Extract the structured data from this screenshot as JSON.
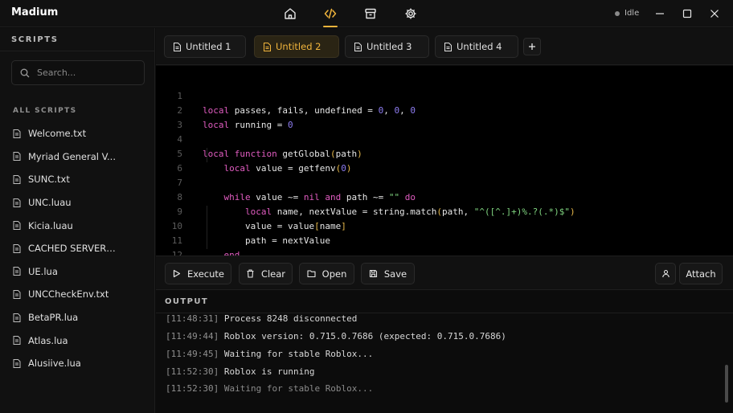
{
  "app": {
    "title": "Madium"
  },
  "nav": [
    {
      "name": "home-icon"
    },
    {
      "name": "code-icon",
      "active": true
    },
    {
      "name": "archive-icon"
    },
    {
      "name": "gear-icon"
    }
  ],
  "status": {
    "label": "Idle"
  },
  "sidebar": {
    "title": "SCRIPTS",
    "search_placeholder": "Search...",
    "section_label": "ALL SCRIPTS",
    "items": [
      {
        "label": "Welcome.txt"
      },
      {
        "label": "Myriad General V..."
      },
      {
        "label": "SUNC.txt"
      },
      {
        "label": "UNC.luau"
      },
      {
        "label": "Kicia.luau"
      },
      {
        "label": "CACHED SERVERH..."
      },
      {
        "label": "UE.lua"
      },
      {
        "label": "UNCCheckEnv.txt"
      },
      {
        "label": "BetaPR.lua"
      },
      {
        "label": "Atlas.lua"
      },
      {
        "label": "Alusiive.lua"
      }
    ]
  },
  "tabs": [
    {
      "label": "Untitled 1"
    },
    {
      "label": "Untitled 2",
      "active": true
    },
    {
      "label": "Untitled 3"
    },
    {
      "label": "Untitled 4"
    }
  ],
  "editor": {
    "lines": [
      {
        "n": "1",
        "text": "local passes, fails, undefined = 0, 0, 0"
      },
      {
        "n": "2",
        "text": "local running = 0"
      },
      {
        "n": "3",
        "text": ""
      },
      {
        "n": "4",
        "text": "local function getGlobal(path)"
      },
      {
        "n": "5",
        "text": "    local value = getfenv(0)"
      },
      {
        "n": "6",
        "text": ""
      },
      {
        "n": "7",
        "text": "    while value ~= nil and path ~= \"\" do"
      },
      {
        "n": "8",
        "text": "        local name, nextValue = string.match(path, \"^([^.]+)%.?(.*)$\")"
      },
      {
        "n": "9",
        "text": "        value = value[name]"
      },
      {
        "n": "10",
        "text": "        path = nextValue"
      },
      {
        "n": "11",
        "text": "    end"
      },
      {
        "n": "12",
        "text": ""
      }
    ]
  },
  "toolbar": {
    "execute": "Execute",
    "clear": "Clear",
    "open": "Open",
    "save": "Save",
    "attach": "Attach"
  },
  "output": {
    "title": "OUTPUT",
    "logs": [
      {
        "ts": "[11:48:31]",
        "msg": "Process 8248 disconnected"
      },
      {
        "ts": "[11:49:44]",
        "msg": "Roblox version: 0.715.0.7686 (expected: 0.715.0.7686)"
      },
      {
        "ts": "[11:49:45]",
        "msg": "Waiting for stable Roblox..."
      },
      {
        "ts": "[11:52:30]",
        "msg": "Roblox is running"
      },
      {
        "ts": "[11:52:30]",
        "msg": "Waiting for stable Roblox..."
      }
    ]
  }
}
